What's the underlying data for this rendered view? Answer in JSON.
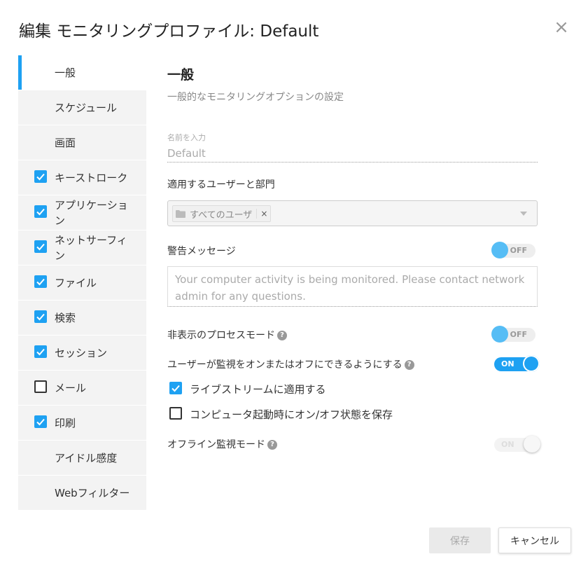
{
  "dialog": {
    "title": "編集 モニタリングプロファイル: Default",
    "close_icon": "close-icon"
  },
  "sidebar": {
    "items": [
      {
        "label": "一般",
        "checkbox": null,
        "active": true
      },
      {
        "label": "スケジュール",
        "checkbox": null
      },
      {
        "label": "画面",
        "checkbox": null
      },
      {
        "label": "キーストローク",
        "checkbox": true
      },
      {
        "label": "アプリケーション",
        "checkbox": true
      },
      {
        "label": "ネットサーフィン",
        "checkbox": true
      },
      {
        "label": "ファイル",
        "checkbox": true
      },
      {
        "label": "検索",
        "checkbox": true
      },
      {
        "label": "セッション",
        "checkbox": true
      },
      {
        "label": "メール",
        "checkbox": false
      },
      {
        "label": "印刷",
        "checkbox": true
      },
      {
        "label": "アイドル感度",
        "checkbox": null
      },
      {
        "label": "Webフィルター",
        "checkbox": null
      }
    ]
  },
  "general": {
    "heading": "一般",
    "subtitle": "一般的なモニタリングオプションの設定",
    "name_label": "名前を入力",
    "name_value": "Default",
    "apply_label": "適用するユーザーと部門",
    "apply_tag": "すべてのユーザ",
    "warning_label": "警告メッセージ",
    "warning_toggle": "OFF",
    "warning_placeholder": "Your computer activity is being monitored. Please contact network admin for any questions.",
    "hidden_label": "非表示のプロセスモード",
    "hidden_toggle": "OFF",
    "user_toggle_label": "ユーザーが監視をオンまたはオフにできるようにする",
    "user_toggle": "ON",
    "live_stream_label": "ライブストリームに適用する",
    "live_stream_checked": true,
    "save_state_label": "コンピュータ起動時にオン/オフ状態を保存",
    "save_state_checked": false,
    "offline_label": "オフライン監視モード",
    "offline_toggle": "ON",
    "help_glyph": "?"
  },
  "footer": {
    "save_label": "保存",
    "cancel_label": "キャンセル"
  },
  "colors": {
    "accent": "#1ea1f2",
    "sidebar_bg": "#f3f3f3"
  }
}
